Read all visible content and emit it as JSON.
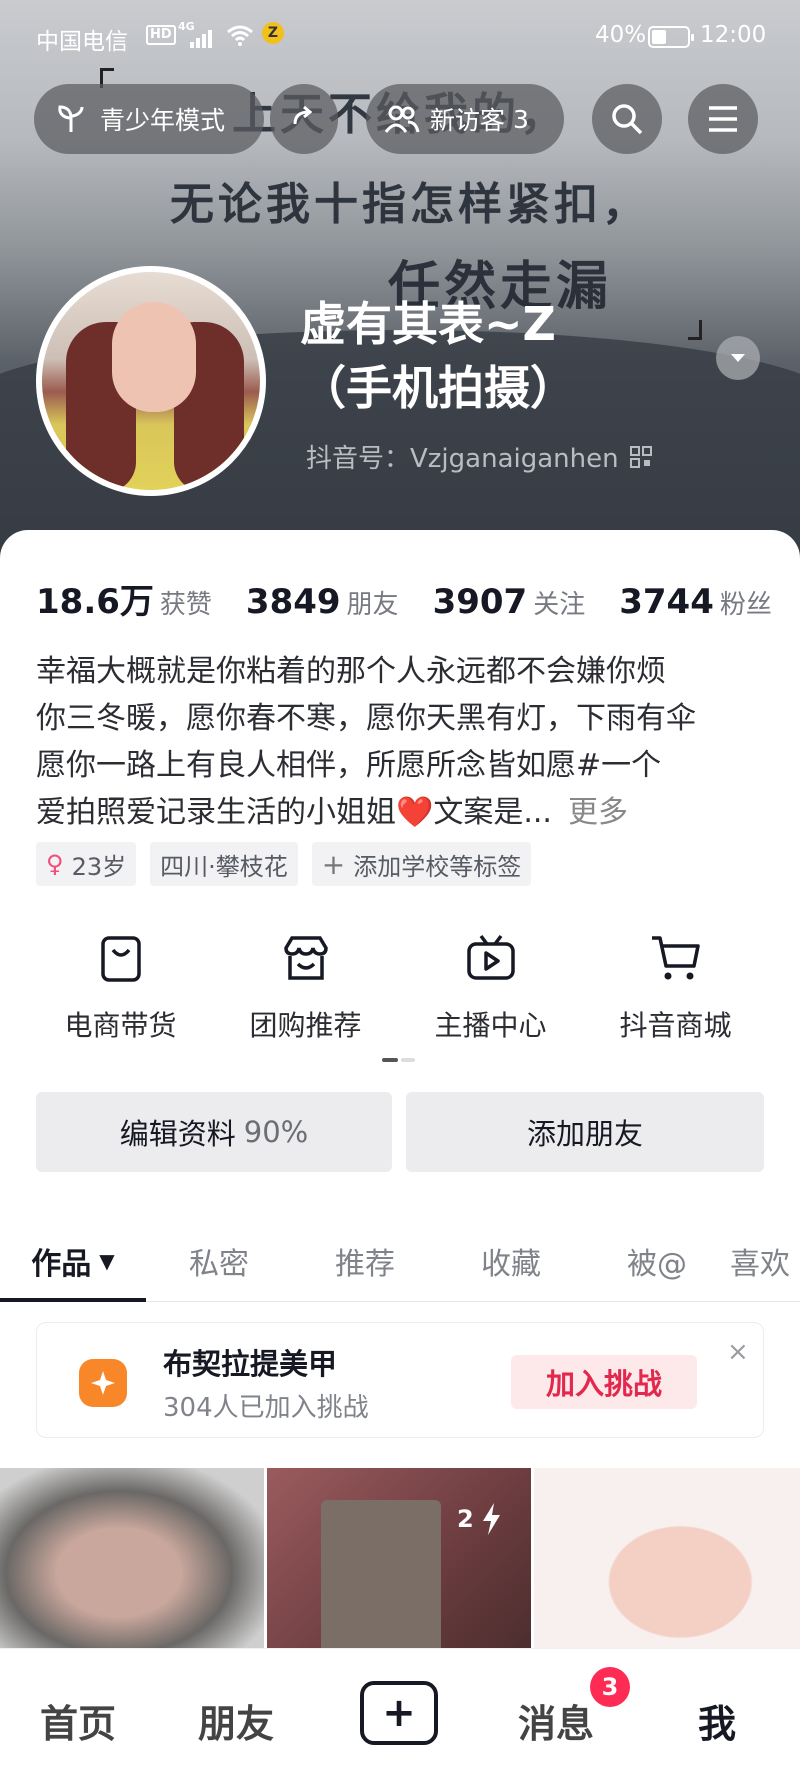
{
  "status_bar": {
    "carrier": "中国电信",
    "hd": "HD",
    "network": "4G",
    "battery_percent": "40%",
    "battery_level": 0.4,
    "time": "12:00"
  },
  "cover": {
    "line1": "上天不给我的，",
    "line2": "无论我十指怎样紧扣，",
    "line3": "任然走漏"
  },
  "top_actions": {
    "youth_mode": "青少年模式",
    "new_visitors_label": "新访客",
    "new_visitors_count": "3"
  },
  "profile": {
    "name_line1": "虚有其表~Z",
    "name_line2": "（手机拍摄）",
    "douyin_id": "抖音号：Vzjganaiganhen"
  },
  "stats": [
    {
      "value": "18.6万",
      "label": "获赞"
    },
    {
      "value": "3849",
      "label": "朋友"
    },
    {
      "value": "3907",
      "label": "关注"
    },
    {
      "value": "3744",
      "label": "粉丝"
    }
  ],
  "bio": {
    "line1": "幸福大概就是你粘着的那个人永远都不会嫌你烦",
    "line2": "你三冬暖，愿你春不寒，愿你天黑有灯，下雨有伞",
    "line3": "愿你一路上有良人相伴，所愿所念皆如愿#一个",
    "line4": "爱拍照爱记录生活的小姐姐",
    "heart": "❤️",
    "line4_tail": "文案是...",
    "more": "更多"
  },
  "tags": {
    "age": "23岁",
    "location": "四川·攀枝花",
    "add_school": "添加学校等标签"
  },
  "services": [
    {
      "label": "电商带货",
      "icon": "shopping-bag-icon"
    },
    {
      "label": "团购推荐",
      "icon": "store-icon"
    },
    {
      "label": "主播中心",
      "icon": "tv-play-icon"
    },
    {
      "label": "抖音商城",
      "icon": "cart-icon"
    }
  ],
  "actions": {
    "edit_profile": "编辑资料",
    "edit_percent": "90%",
    "add_friend": "添加朋友"
  },
  "tabs": [
    {
      "label": "作品",
      "active": true
    },
    {
      "label": "私密"
    },
    {
      "label": "推荐"
    },
    {
      "label": "收藏"
    },
    {
      "label": "被@"
    },
    {
      "label": "喜欢"
    }
  ],
  "challenge": {
    "title": "布契拉提美甲",
    "subtitle": "304人已加入挑战",
    "join": "加入挑战",
    "close": "×"
  },
  "grid": {
    "thumb2_badge": "2"
  },
  "bottom_nav": {
    "home": "首页",
    "friends": "朋友",
    "plus": "+",
    "messages": "消息",
    "messages_badge": "3",
    "me": "我"
  },
  "colors": {
    "accent": "#fe2c55",
    "challenge_icon": "#f8872a",
    "gender_female": "#f04f7a"
  }
}
